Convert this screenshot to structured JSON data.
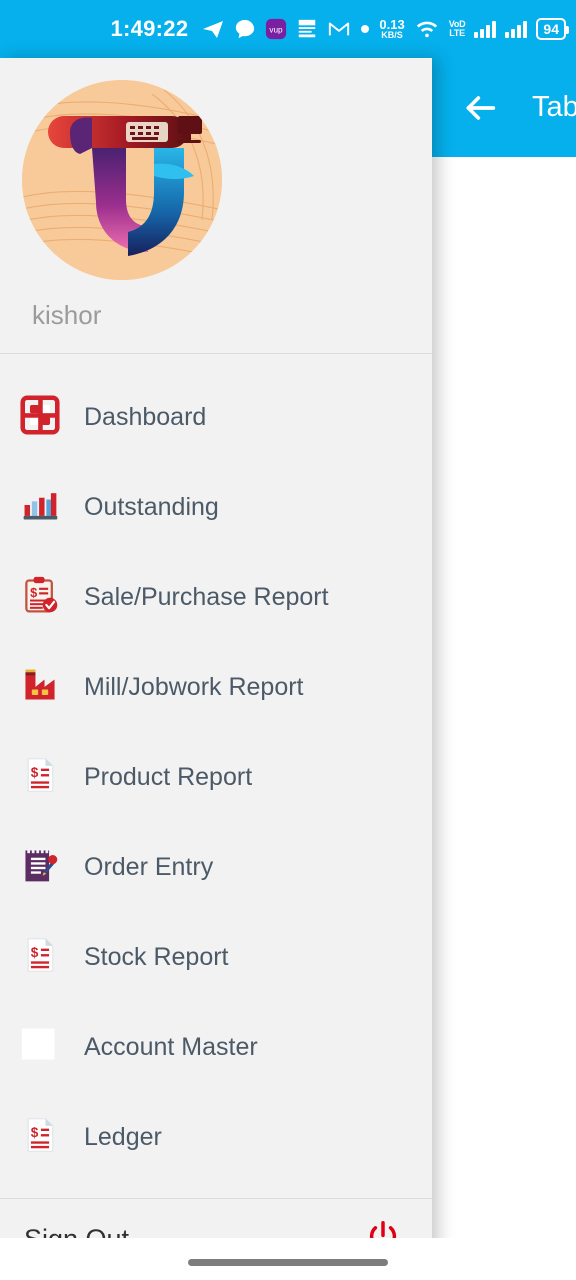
{
  "statusbar": {
    "time": "1:49:22",
    "icons": [
      "telegram-icon",
      "chat-bubble-icon",
      "vup-app-icon",
      "news-app-icon",
      "gmail-icon",
      "dot-icon"
    ],
    "network_speed_value": "0.13",
    "network_speed_unit": "KB/S",
    "wifi": "wifi-icon",
    "volte_line1": "VoD",
    "volte_line2": "LTE",
    "battery": "94",
    "background_color": "#05b0ec"
  },
  "appbar": {
    "back_icon": "back-arrow-icon",
    "title": "Tab",
    "background_color": "#05b0ec"
  },
  "drawer": {
    "profile": {
      "avatar": "app-logo-avatar",
      "username": "kishor"
    },
    "items": [
      {
        "label": "Dashboard",
        "icon": "dashboard-grid-icon"
      },
      {
        "label": "Outstanding",
        "icon": "bar-chart-icon"
      },
      {
        "label": "Sale/Purchase Report",
        "icon": "clipboard-dollar-icon"
      },
      {
        "label": "Mill/Jobwork Report",
        "icon": "factory-icon"
      },
      {
        "label": "Product Report",
        "icon": "document-dollar-icon"
      },
      {
        "label": "Order Entry",
        "icon": "notepad-pen-icon"
      },
      {
        "label": "Stock Report",
        "icon": "document-dollar-icon"
      },
      {
        "label": "Account Master",
        "icon": "blank-square-icon"
      },
      {
        "label": "Ledger",
        "icon": "document-dollar-icon"
      }
    ],
    "footer": {
      "label": "Sign Out",
      "icon": "power-icon"
    }
  },
  "colors": {
    "accent": "#05b0ec",
    "icon_red": "#d0232b",
    "menu_text": "#4c5a68",
    "drawer_bg": "#f2f2f2"
  }
}
